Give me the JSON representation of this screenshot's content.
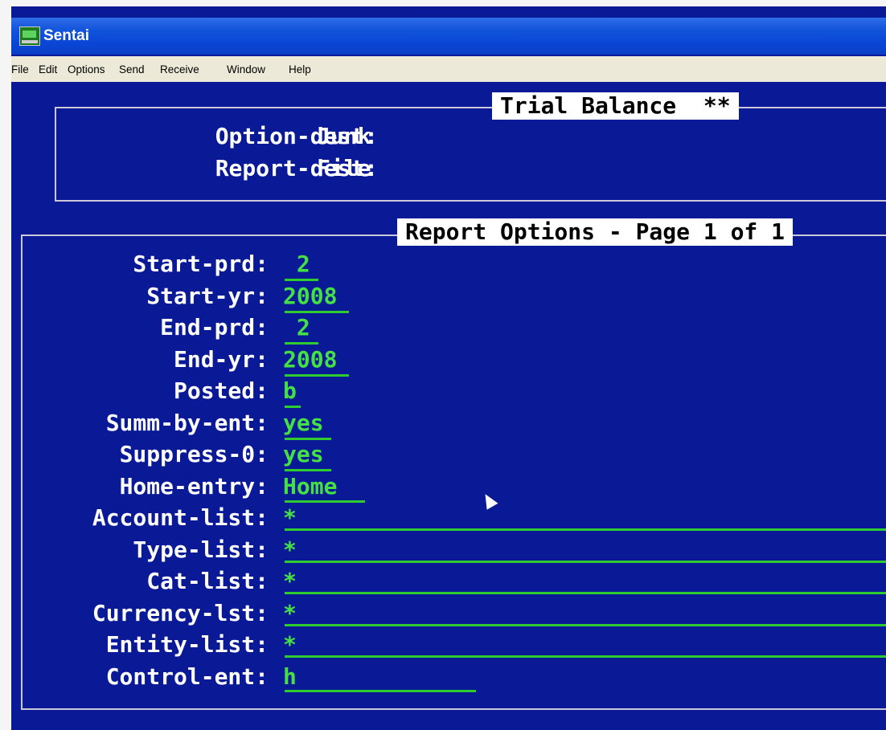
{
  "window": {
    "title": "Sentai"
  },
  "menu": [
    "File",
    "Edit",
    "Options",
    "Send",
    "Receive",
    "Window",
    "Help"
  ],
  "header_box": {
    "title": "Trial Balance  **",
    "rows": [
      {
        "label": "Option-dest:",
        "value": "Junk"
      },
      {
        "label": "Report-dest:",
        "value": "File"
      }
    ]
  },
  "options_box": {
    "title": "Report Options - Page 1 of 1",
    "fields": [
      {
        "label": "Start-prd:",
        "value": " 2"
      },
      {
        "label": "Start-yr:",
        "value": "2008"
      },
      {
        "label": "End-prd:",
        "value": " 2"
      },
      {
        "label": "End-yr:",
        "value": "2008"
      },
      {
        "label": "Posted:",
        "value": "b"
      },
      {
        "label": "Summ-by-ent:",
        "value": "yes"
      },
      {
        "label": "Suppress-0:",
        "value": "yes"
      },
      {
        "label": "Home-entry:",
        "value": "Home"
      },
      {
        "label": "Account-list:",
        "value": "*"
      },
      {
        "label": "Type-list:",
        "value": "*"
      },
      {
        "label": "Cat-list:",
        "value": "*"
      },
      {
        "label": "Currency-lst:",
        "value": "*"
      },
      {
        "label": "Entity-list:",
        "value": "*"
      },
      {
        "label": "Control-ent:",
        "value": "h"
      }
    ]
  }
}
